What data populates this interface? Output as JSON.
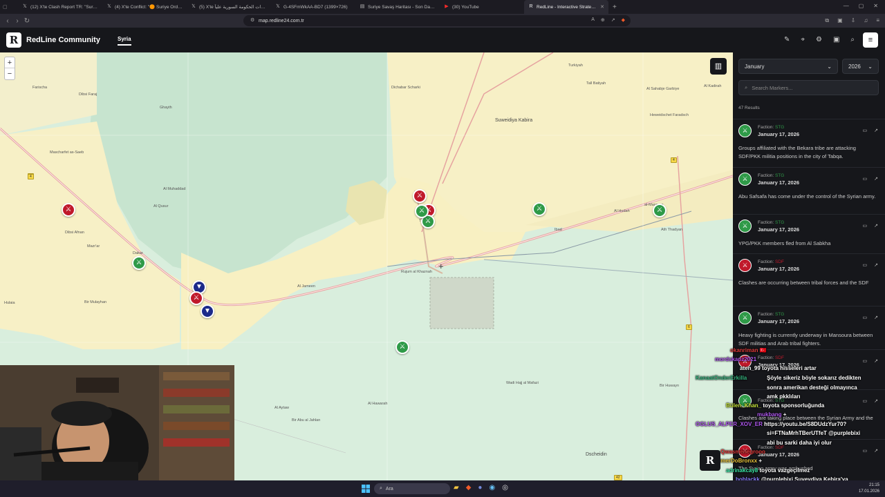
{
  "browser": {
    "tabs": [
      {
        "title": "(12) X'te Clash Report TR: \"Suriye ordu…",
        "icon": "x-icon"
      },
      {
        "title": "(4) X'te Conflict: \"🟠 Suriye Ordusu…",
        "icon": "x-icon"
      },
      {
        "title": "(5) X'te قوات الحكومة السورية علياً :\"…",
        "icon": "x-icon"
      },
      {
        "title": "G-4SFmWkAA-BD7 (1399×726)",
        "icon": "x-icon"
      },
      {
        "title": "Suriye Savaş Haritası - Son Dakika S…",
        "icon": "doc-icon"
      },
      {
        "title": "(30) YouTube",
        "icon": "youtube-icon"
      },
      {
        "title": "RedLine - Interactive Strategic M…",
        "icon": "redline-icon",
        "active": true
      }
    ],
    "url": "map.redline24.com.tr"
  },
  "header": {
    "brand": "RedLine Community",
    "logo_letter": "R",
    "region_tab": "Syria"
  },
  "map": {
    "zoom_in": "+",
    "zoom_out": "−",
    "labels": [
      {
        "text": "Turkiyah",
        "cls": ""
      },
      {
        "text": "Dibsi Faraj",
        "cls": ""
      },
      {
        "text": "Dibsi Afnan",
        "cls": ""
      },
      {
        "text": "Mascharfet as-Saeb",
        "cls": ""
      },
      {
        "text": "Al Muhaddad",
        "cls": ""
      },
      {
        "text": "Al Qusur",
        "cls": ""
      },
      {
        "text": "Mazr'ar",
        "cls": ""
      },
      {
        "text": "Hulaia",
        "cls": ""
      },
      {
        "text": "Bir Mulayhan",
        "cls": ""
      },
      {
        "text": "Al Jameen",
        "cls": ""
      },
      {
        "text": "Rujum al Khaznah",
        "cls": ""
      },
      {
        "text": "Suweidiya Kabira",
        "cls": "big"
      },
      {
        "text": "Dichabar Scharki",
        "cls": ""
      },
      {
        "text": "Tall Batiyah",
        "cls": ""
      },
      {
        "text": "Al Sahabje Garbiye",
        "cls": ""
      },
      {
        "text": "Al Kadirah",
        "cls": ""
      },
      {
        "text": "Heweidschet Faradsch",
        "cls": ""
      },
      {
        "text": "al-Mansura",
        "cls": ""
      },
      {
        "text": "Al Hudah",
        "cls": ""
      },
      {
        "text": "Ath Thadyan",
        "cls": ""
      },
      {
        "text": "Ibad",
        "cls": ""
      },
      {
        "text": "Bir Huwayn",
        "cls": ""
      },
      {
        "text": "Dscheidin",
        "cls": "big"
      },
      {
        "text": "Wadi Hajj al Mafazi",
        "cls": ""
      },
      {
        "text": "Al Hawarah",
        "cls": ""
      },
      {
        "text": "Bir Abu al Jahlan",
        "cls": ""
      },
      {
        "text": "Al Aytaw",
        "cls": ""
      },
      {
        "text": "Ghayth",
        "cls": ""
      },
      {
        "text": "Farischa",
        "cls": ""
      },
      {
        "text": "Dakar",
        "cls": ""
      },
      {
        "text": "Tabqa",
        "cls": ""
      }
    ],
    "road_signs": [
      "4",
      "4",
      "4",
      "6",
      "42"
    ],
    "markers": [
      {
        "faction": "SDF",
        "color": "#c0192b"
      },
      {
        "faction": "STG",
        "color": "#2f9a48"
      },
      {
        "faction": "SDF",
        "color": "#c0192b"
      },
      {
        "faction": "SDF",
        "color": "#c0192b"
      },
      {
        "faction": "STG",
        "color": "#2f9a48"
      },
      {
        "faction": "STG",
        "color": "#2f9a48"
      },
      {
        "faction": "STG",
        "color": "#2f9a48"
      },
      {
        "faction": "NAV",
        "color": "#1c2a8a"
      },
      {
        "faction": "SDF",
        "color": "#c0192b"
      },
      {
        "faction": "NAV",
        "color": "#1c2a8a"
      },
      {
        "faction": "STG",
        "color": "#2f9a48"
      },
      {
        "faction": "STG",
        "color": "#2f9a48"
      }
    ]
  },
  "sidebar": {
    "month": "January",
    "year": "2026",
    "search_placeholder": "Search Markers...",
    "results": "47 Results",
    "entries": [
      {
        "faction_label": "Faction:",
        "faction": "STG",
        "color": "#2f9a48",
        "date": "January 17, 2026",
        "text": "Groups affiliated with the Bekara tribe are attacking SDF/PKK militia positions in the city of Tabqa."
      },
      {
        "faction_label": "Faction:",
        "faction": "STG",
        "color": "#2f9a48",
        "date": "January 17, 2026",
        "text": "Abu Safsafa has come under the control of the Syrian army."
      },
      {
        "faction_label": "Faction:",
        "faction": "STG",
        "color": "#2f9a48",
        "date": "January 17, 2026",
        "text": "YPG/PKK members fled from Al Sabkha"
      },
      {
        "faction_label": "Faction:",
        "faction": "SDF",
        "color": "#c0192b",
        "date": "January 17, 2026",
        "text": "Clashes are occurring between tribal forces and the SDF"
      },
      {
        "faction_label": "Faction:",
        "faction": "STG",
        "color": "#2f9a48",
        "date": "January 17, 2026",
        "text": "Heavy fighting is currently underway in Mansoura between SDF militias and Arab tribal fighters."
      },
      {
        "faction_label": "Faction:",
        "faction": "SDF",
        "color": "#c0192b",
        "date": "January 17, 2026",
        "text": ""
      },
      {
        "faction_label": "Faction:",
        "faction": "STG",
        "color": "#2f9a48",
        "date": "",
        "text": "Clashes are taking place between the Syrian Army and the"
      },
      {
        "faction_label": "Faction:",
        "faction": "SDF",
        "color": "#c0192b",
        "date": "January 17, 2026",
        "text": "The Syrian army was ambushed"
      }
    ]
  },
  "chat": {
    "logo_letter": "R",
    "lines": [
      {
        "user": "okanriman",
        "color": "#e23b3b",
        "msg": "🇹🇷"
      },
      {
        "user": "mordskapz2021",
        "color": "#b058f0",
        "msg": ""
      },
      {
        "user": "aten_99",
        "color": "#ffffff",
        "msg": "toyota hisseleri artar"
      },
      {
        "user": "",
        "color": "#ffffff",
        "msg": "Şöyle sikeriz böyle sokarız dedikten"
      },
      {
        "user": "KanaatOnderErkilla",
        "color": "#36b37e",
        "msg": ""
      },
      {
        "user": "",
        "color": "#ffffff",
        "msg": "sonra amerikan desteği olmayınca"
      },
      {
        "user": "",
        "color": "#ffffff",
        "msg": "amk pkklıları"
      },
      {
        "user": "Bülen_Khan_",
        "color": "#c8e63b",
        "msg": "toyota sponsorluğunda"
      },
      {
        "user": "mukbang",
        "color": "#b058f0",
        "msg": "+"
      },
      {
        "user": "OGLUS_ALPER_XOV_ER",
        "color": "#b058f0",
        "msg": "https://youtu.be/S8DUdzYur70?"
      },
      {
        "user": "",
        "color": "#ffffff",
        "msg": "si=FTNaMrhTBerUTfeT @purplebixi"
      },
      {
        "user": "",
        "color": "#ffffff",
        "msg": "abi bu sarki daha iyi olur"
      },
      {
        "user": "Qwasmenegrooo",
        "color": "#e23b3b",
        "msg": ""
      },
      {
        "user": "OmerDoBronxx",
        "color": "#e8c23b",
        "msg": "+"
      },
      {
        "user": "adrinakcay8",
        "color": "#3be8a8",
        "msg": "toyota vazgeçilmez"
      },
      {
        "user": "boblackk",
        "color": "#8a7dff",
        "msg": "@purplebixi Suveydiya Kebira'ya"
      },
      {
        "user": "",
        "color": "#ffffff",
        "msg": "girmişler katşıya geçmişler"
      }
    ]
  },
  "taskbar": {
    "search_label": "Ara",
    "time": "21:15",
    "date": "17.01.2026"
  }
}
